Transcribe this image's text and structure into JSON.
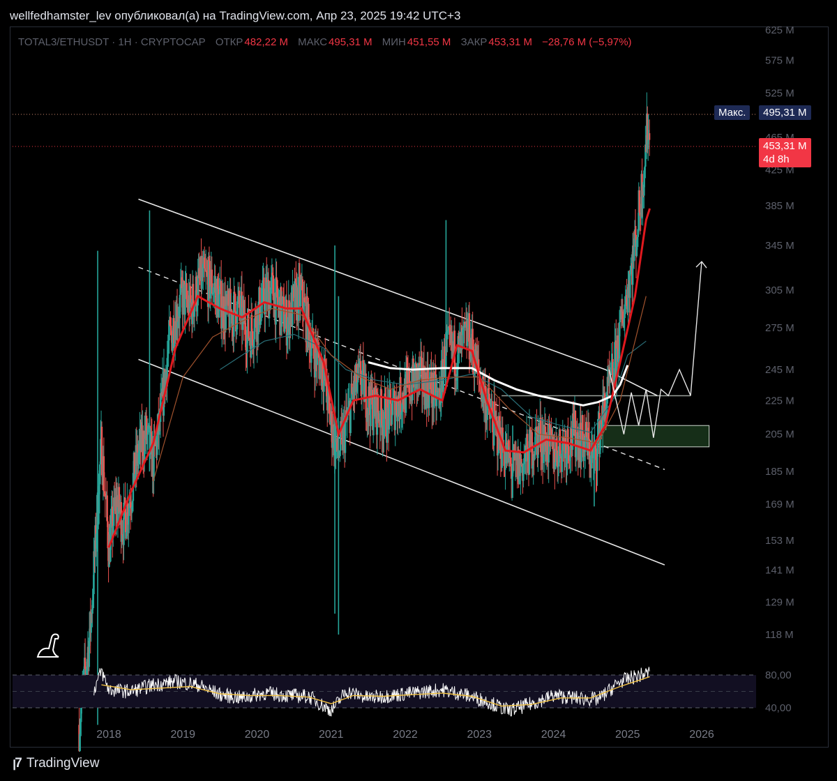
{
  "header": {
    "author_line": "wellfedhamster_lev опубликовал(а) на TradingView.com, Апр 23, 2025 19:42 UTC+3"
  },
  "legend": {
    "symbol": "TOTAL3/ETHUSDT · 1H · CRYPTOCAP",
    "open_label": "ОТКР",
    "open_value": "482,22 M",
    "high_label": "МАКС",
    "high_value": "495,31 M",
    "low_label": "МИН",
    "low_value": "451,55 M",
    "close_label": "ЗАКР",
    "close_value": "453,31 M",
    "change": "−28,76 M (−5,97%)"
  },
  "price_labels": {
    "max_tag": "Макс.",
    "max_value": "495,31 M",
    "last_value": "453,31 M",
    "countdown": "4d 8h"
  },
  "footer": {
    "brand": "TradingView"
  },
  "colors": {
    "up": "#26a69a",
    "down": "#ef5350",
    "accent_red": "#f23645",
    "max_tag_bg": "#1e2a55",
    "rsi_line": "#ffffff",
    "rsi_ma": "#f0c040"
  },
  "chart_data": {
    "type": "candlestick",
    "scale": "log",
    "y_ticks": [
      "625 M",
      "575 M",
      "525 M",
      "465 M",
      "425 M",
      "385 M",
      "345 M",
      "305 M",
      "275 M",
      "245 M",
      "225 M",
      "205 M",
      "185 M",
      "169 M",
      "153 M",
      "141 M",
      "129 M",
      "118 M"
    ],
    "y_tick_values": [
      625,
      575,
      525,
      465,
      425,
      385,
      345,
      305,
      275,
      245,
      225,
      205,
      185,
      169,
      153,
      141,
      129,
      118
    ],
    "x_ticks": [
      "2018",
      "2019",
      "2020",
      "2021",
      "2022",
      "2023",
      "2024",
      "2025",
      "2026"
    ],
    "x_tick_values": [
      2018,
      2019,
      2020,
      2021,
      2022,
      2023,
      2024,
      2025,
      2026
    ],
    "xlim": [
      2017.3,
      2026.4
    ],
    "ylim": [
      110,
      640
    ],
    "close_series": [
      [
        2017.6,
        92
      ],
      [
        2017.75,
        120
      ],
      [
        2017.9,
        200
      ],
      [
        2018.0,
        150
      ],
      [
        2018.1,
        170
      ],
      [
        2018.2,
        160
      ],
      [
        2018.3,
        175
      ],
      [
        2018.4,
        195
      ],
      [
        2018.5,
        205
      ],
      [
        2018.6,
        190
      ],
      [
        2018.7,
        215
      ],
      [
        2018.8,
        260
      ],
      [
        2018.9,
        285
      ],
      [
        2019.0,
        300
      ],
      [
        2019.1,
        290
      ],
      [
        2019.25,
        315
      ],
      [
        2019.4,
        310
      ],
      [
        2019.5,
        295
      ],
      [
        2019.6,
        285
      ],
      [
        2019.75,
        290
      ],
      [
        2019.9,
        270
      ],
      [
        2020.0,
        285
      ],
      [
        2020.1,
        300
      ],
      [
        2020.2,
        305
      ],
      [
        2020.3,
        290
      ],
      [
        2020.4,
        280
      ],
      [
        2020.5,
        295
      ],
      [
        2020.6,
        300
      ],
      [
        2020.75,
        260
      ],
      [
        2020.9,
        245
      ],
      [
        2021.0,
        210
      ],
      [
        2021.1,
        195
      ],
      [
        2021.2,
        210
      ],
      [
        2021.3,
        230
      ],
      [
        2021.4,
        240
      ],
      [
        2021.5,
        225
      ],
      [
        2021.6,
        220
      ],
      [
        2021.75,
        215
      ],
      [
        2021.9,
        225
      ],
      [
        2022.0,
        230
      ],
      [
        2022.15,
        240
      ],
      [
        2022.3,
        235
      ],
      [
        2022.45,
        225
      ],
      [
        2022.55,
        260
      ],
      [
        2022.7,
        255
      ],
      [
        2022.85,
        270
      ],
      [
        2023.0,
        240
      ],
      [
        2023.15,
        215
      ],
      [
        2023.3,
        200
      ],
      [
        2023.45,
        185
      ],
      [
        2023.6,
        190
      ],
      [
        2023.8,
        205
      ],
      [
        2024.0,
        195
      ],
      [
        2024.15,
        200
      ],
      [
        2024.3,
        205
      ],
      [
        2024.45,
        200
      ],
      [
        2024.55,
        190
      ],
      [
        2024.65,
        215
      ],
      [
        2024.8,
        240
      ],
      [
        2024.95,
        290
      ],
      [
        2025.1,
        345
      ],
      [
        2025.2,
        410
      ],
      [
        2025.27,
        480
      ],
      [
        2025.3,
        453
      ]
    ],
    "wicks": [
      [
        2017.85,
        92,
        340
      ],
      [
        2018.55,
        185,
        380
      ],
      [
        2021.05,
        125,
        345
      ],
      [
        2021.1,
        118,
        300
      ],
      [
        2022.55,
        255,
        370
      ],
      [
        2023.45,
        172,
        210
      ],
      [
        2024.55,
        168,
        205
      ],
      [
        2025.28,
        450,
        495
      ]
    ],
    "ema_fast": [
      [
        2018.0,
        150
      ],
      [
        2018.3,
        175
      ],
      [
        2018.6,
        200
      ],
      [
        2018.9,
        260
      ],
      [
        2019.2,
        300
      ],
      [
        2019.5,
        290
      ],
      [
        2019.8,
        283
      ],
      [
        2020.1,
        295
      ],
      [
        2020.4,
        290
      ],
      [
        2020.6,
        290
      ],
      [
        2020.9,
        250
      ],
      [
        2021.1,
        205
      ],
      [
        2021.3,
        225
      ],
      [
        2021.6,
        228
      ],
      [
        2021.9,
        225
      ],
      [
        2022.2,
        232
      ],
      [
        2022.5,
        225
      ],
      [
        2022.7,
        262
      ],
      [
        2022.9,
        258
      ],
      [
        2023.1,
        225
      ],
      [
        2023.35,
        196
      ],
      [
        2023.6,
        195
      ],
      [
        2023.9,
        202
      ],
      [
        2024.2,
        200
      ],
      [
        2024.5,
        196
      ],
      [
        2024.7,
        210
      ],
      [
        2024.9,
        250
      ],
      [
        2025.1,
        300
      ],
      [
        2025.25,
        370
      ],
      [
        2025.3,
        382
      ]
    ],
    "ma_white": [
      [
        2021.5,
        250
      ],
      [
        2021.8,
        246
      ],
      [
        2022.1,
        245
      ],
      [
        2022.5,
        246
      ],
      [
        2022.9,
        246
      ],
      [
        2023.2,
        238
      ],
      [
        2023.5,
        232
      ],
      [
        2023.8,
        228
      ],
      [
        2024.1,
        225
      ],
      [
        2024.4,
        222
      ],
      [
        2024.6,
        224
      ],
      [
        2024.8,
        228
      ],
      [
        2024.9,
        235
      ],
      [
        2025.0,
        248
      ]
    ],
    "ma_teal": [
      [
        2019.5,
        245
      ],
      [
        2019.8,
        255
      ],
      [
        2020.1,
        265
      ],
      [
        2020.5,
        270
      ],
      [
        2020.9,
        260
      ],
      [
        2021.2,
        245
      ],
      [
        2021.6,
        238
      ],
      [
        2022.0,
        235
      ],
      [
        2022.5,
        238
      ],
      [
        2022.9,
        242
      ],
      [
        2023.3,
        232
      ],
      [
        2023.7,
        215
      ],
      [
        2024.1,
        210
      ],
      [
        2024.5,
        206
      ],
      [
        2024.8,
        225
      ],
      [
        2025.0,
        255
      ],
      [
        2025.25,
        265
      ]
    ],
    "ma_orange": [
      [
        2018.6,
        180
      ],
      [
        2019.0,
        240
      ],
      [
        2019.4,
        268
      ],
      [
        2019.8,
        280
      ],
      [
        2020.2,
        290
      ],
      [
        2020.6,
        285
      ],
      [
        2021.0,
        255
      ],
      [
        2021.4,
        240
      ],
      [
        2021.8,
        232
      ],
      [
        2022.2,
        238
      ],
      [
        2022.6,
        240
      ],
      [
        2023.0,
        240
      ],
      [
        2023.4,
        220
      ],
      [
        2023.8,
        205
      ],
      [
        2024.2,
        203
      ],
      [
        2024.6,
        200
      ],
      [
        2024.9,
        225
      ],
      [
        2025.1,
        265
      ],
      [
        2025.25,
        300
      ]
    ],
    "channel_upper": [
      [
        2018.4,
        392
      ],
      [
        2024.7,
        245
      ],
      [
        2025.4,
        228
      ]
    ],
    "channel_mid": [
      [
        2018.4,
        325
      ],
      [
        2025.5,
        186
      ]
    ],
    "channel_lower": [
      [
        2018.4,
        252
      ],
      [
        2025.5,
        143
      ]
    ],
    "resistance": {
      "x0": 2023.3,
      "x1": 2025.85,
      "y": 228
    },
    "demand_zone": {
      "x0": 2024.6,
      "x1": 2026.1,
      "y0": 198,
      "y1": 210
    },
    "projection": [
      [
        2024.75,
        245
      ],
      [
        2024.95,
        205
      ],
      [
        2025.05,
        230
      ],
      [
        2025.15,
        210
      ],
      [
        2025.25,
        232
      ],
      [
        2025.35,
        203
      ],
      [
        2025.45,
        232
      ],
      [
        2025.55,
        228
      ],
      [
        2025.7,
        245
      ],
      [
        2025.85,
        228
      ],
      [
        2026.0,
        330
      ]
    ],
    "rsi": {
      "levels": [
        80,
        40
      ],
      "level_labels": [
        "80,00",
        "40,00"
      ],
      "values": [
        [
          2017.8,
          62
        ],
        [
          2017.9,
          85
        ],
        [
          2018.0,
          62
        ],
        [
          2018.3,
          60
        ],
        [
          2018.6,
          68
        ],
        [
          2018.9,
          72
        ],
        [
          2019.2,
          68
        ],
        [
          2019.5,
          56
        ],
        [
          2019.8,
          52
        ],
        [
          2020.1,
          58
        ],
        [
          2020.4,
          55
        ],
        [
          2020.7,
          54
        ],
        [
          2021.0,
          36
        ],
        [
          2021.2,
          60
        ],
        [
          2021.5,
          52
        ],
        [
          2021.8,
          55
        ],
        [
          2022.1,
          58
        ],
        [
          2022.5,
          62
        ],
        [
          2022.8,
          56
        ],
        [
          2023.1,
          48
        ],
        [
          2023.4,
          36
        ],
        [
          2023.7,
          45
        ],
        [
          2024.0,
          55
        ],
        [
          2024.3,
          52
        ],
        [
          2024.6,
          50
        ],
        [
          2024.9,
          72
        ],
        [
          2025.1,
          78
        ],
        [
          2025.3,
          83
        ]
      ],
      "ma": [
        [
          2017.9,
          68
        ],
        [
          2018.3,
          62
        ],
        [
          2018.7,
          64
        ],
        [
          2019.1,
          66
        ],
        [
          2019.5,
          57
        ],
        [
          2019.9,
          55
        ],
        [
          2020.3,
          55
        ],
        [
          2020.7,
          53
        ],
        [
          2021.0,
          45
        ],
        [
          2021.3,
          55
        ],
        [
          2021.7,
          54
        ],
        [
          2022.1,
          56
        ],
        [
          2022.5,
          58
        ],
        [
          2022.9,
          54
        ],
        [
          2023.3,
          42
        ],
        [
          2023.7,
          44
        ],
        [
          2024.1,
          52
        ],
        [
          2024.5,
          52
        ],
        [
          2024.9,
          66
        ],
        [
          2025.3,
          78
        ]
      ]
    }
  }
}
